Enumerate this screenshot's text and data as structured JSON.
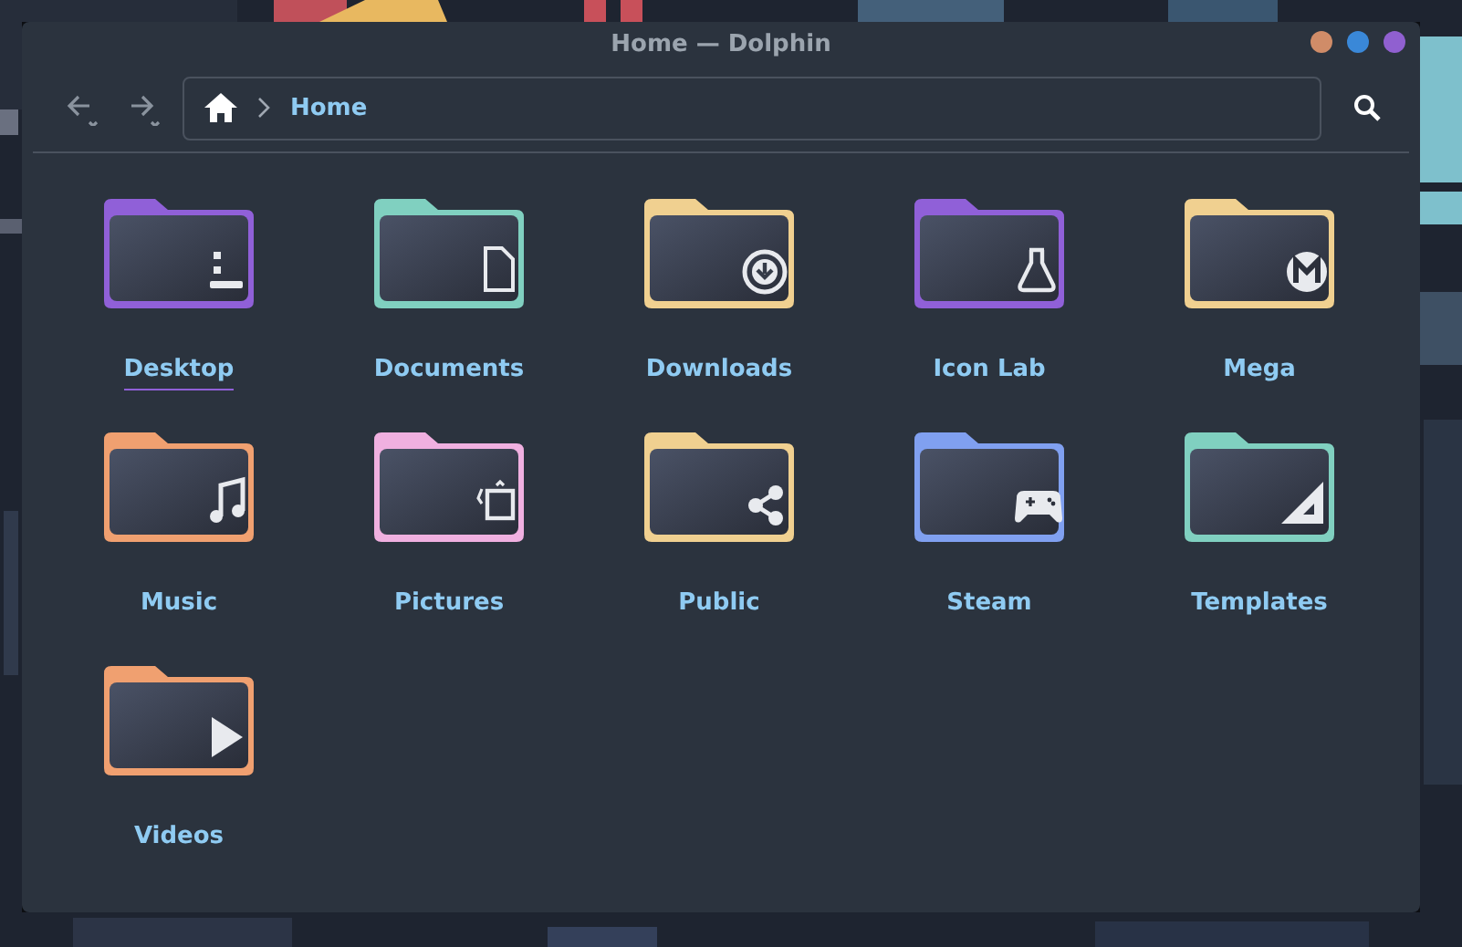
{
  "window": {
    "title": "Home — Dolphin"
  },
  "toolbar": {
    "breadcrumb": [
      {
        "label": "Home",
        "kind": "home"
      }
    ]
  },
  "folders": [
    {
      "name": "Desktop",
      "kind": "desktop",
      "color": "#9060d8",
      "current": true
    },
    {
      "name": "Documents",
      "kind": "document",
      "color": "#80d0c0",
      "current": false
    },
    {
      "name": "Downloads",
      "kind": "download",
      "color": "#f0d090",
      "current": false
    },
    {
      "name": "Icon Lab",
      "kind": "flask",
      "color": "#9060d8",
      "current": false
    },
    {
      "name": "Mega",
      "kind": "mega",
      "color": "#f0d090",
      "current": false
    },
    {
      "name": "Music",
      "kind": "music",
      "color": "#f0a070",
      "current": false
    },
    {
      "name": "Pictures",
      "kind": "pictures",
      "color": "#f0b0e0",
      "current": false
    },
    {
      "name": "Public",
      "kind": "share",
      "color": "#f0d090",
      "current": false
    },
    {
      "name": "Steam",
      "kind": "gamepad",
      "color": "#80a0f0",
      "current": false
    },
    {
      "name": "Templates",
      "kind": "ruler",
      "color": "#80d0c0",
      "current": false
    },
    {
      "name": "Videos",
      "kind": "play",
      "color": "#f0a070",
      "current": false
    }
  ]
}
